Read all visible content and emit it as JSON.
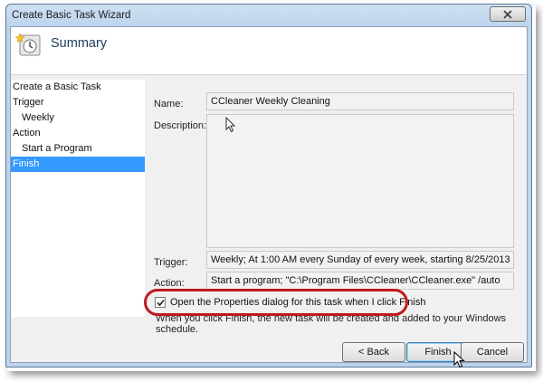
{
  "window": {
    "title": "Create Basic Task Wizard",
    "close_icon": "close-icon"
  },
  "header": {
    "title": "Summary",
    "icon": "task-scheduler-icon"
  },
  "nav": {
    "items": [
      {
        "label": "Create a Basic Task"
      },
      {
        "label": "Trigger"
      },
      {
        "label": "Weekly"
      },
      {
        "label": "Action"
      },
      {
        "label": "Start a Program"
      },
      {
        "label": "Finish"
      }
    ],
    "selected_color": "#3399ff"
  },
  "summary": {
    "name_label": "Name:",
    "name_value": "CCleaner Weekly Cleaning",
    "description_label": "Description:",
    "description_value": "",
    "trigger_label": "Trigger:",
    "trigger_value": "Weekly; At 1:00 AM every Sunday of every week, starting 8/25/2013",
    "action_label": "Action:",
    "action_value": "Start a program; \"C:\\Program Files\\CCleaner\\CCleaner.exe\" /auto"
  },
  "options": {
    "open_properties_label": "Open the Properties dialog for this task when I click Finish",
    "open_properties_checked": true,
    "info_text": "When you click Finish, the new task will be created and added to your Windows schedule."
  },
  "buttons": {
    "back": "< Back",
    "finish": "Finish",
    "cancel": "Cancel"
  },
  "annotation": {
    "highlight_color": "#c0181e"
  }
}
